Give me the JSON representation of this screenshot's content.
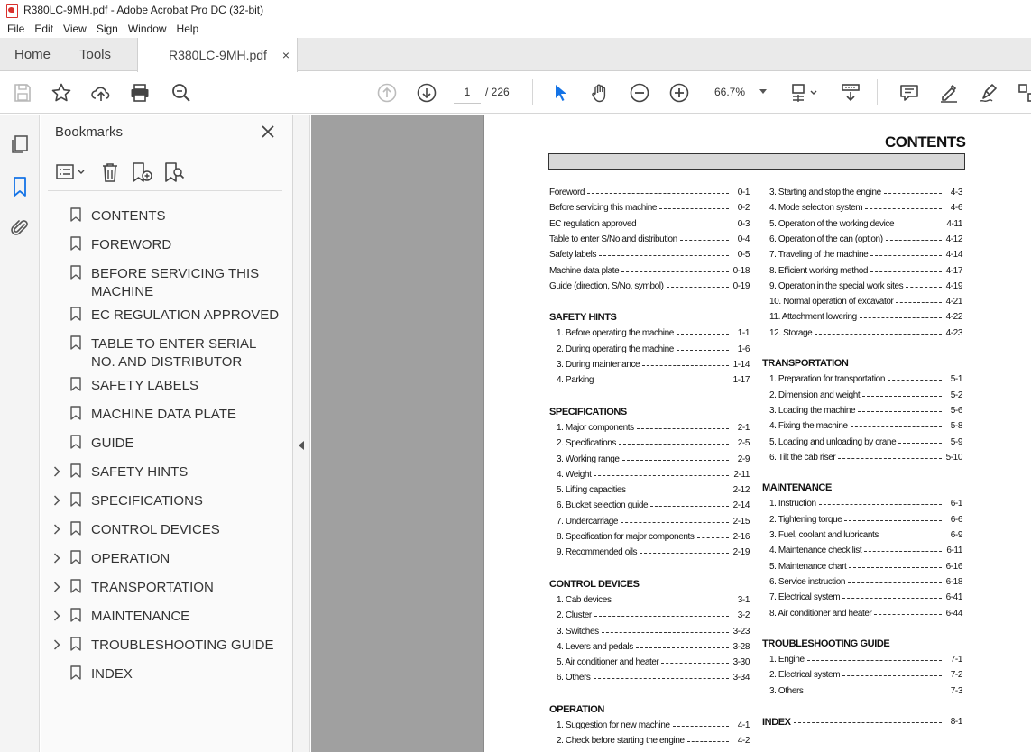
{
  "window": {
    "title": "R380LC-9MH.pdf - Adobe Acrobat Pro DC (32-bit)"
  },
  "menu": [
    "File",
    "Edit",
    "View",
    "Sign",
    "Window",
    "Help"
  ],
  "tabs": {
    "home": "Home",
    "tools": "Tools",
    "document": "R380LC-9MH.pdf",
    "close": "×"
  },
  "toolbar": {
    "page_current": "1",
    "page_total": "/ 226",
    "zoom": "66.7%"
  },
  "bookmarks": {
    "title": "Bookmarks",
    "items": [
      {
        "label": "CONTENTS",
        "expandable": false
      },
      {
        "label": "FOREWORD",
        "expandable": false
      },
      {
        "label": "BEFORE SERVICING THIS MACHINE",
        "expandable": false
      },
      {
        "label": "EC REGULATION APPROVED",
        "expandable": false
      },
      {
        "label": "TABLE TO ENTER SERIAL NO. AND DISTRIBUTOR",
        "expandable": false
      },
      {
        "label": "SAFETY LABELS",
        "expandable": false
      },
      {
        "label": "MACHINE DATA PLATE",
        "expandable": false
      },
      {
        "label": "GUIDE",
        "expandable": false
      },
      {
        "label": "SAFETY HINTS",
        "expandable": true
      },
      {
        "label": "SPECIFICATIONS",
        "expandable": true
      },
      {
        "label": "CONTROL DEVICES",
        "expandable": true
      },
      {
        "label": "OPERATION",
        "expandable": true
      },
      {
        "label": "TRANSPORTATION",
        "expandable": true
      },
      {
        "label": "MAINTENANCE",
        "expandable": true
      },
      {
        "label": "TROUBLESHOOTING GUIDE",
        "expandable": true
      },
      {
        "label": "INDEX",
        "expandable": false
      }
    ]
  },
  "document": {
    "title": "CONTENTS",
    "left": [
      {
        "kind": "line",
        "t": "Foreword",
        "p": "0-1"
      },
      {
        "kind": "line",
        "t": "Before servicing this machine",
        "p": "0-2"
      },
      {
        "kind": "line",
        "t": "EC regulation approved",
        "p": "0-3"
      },
      {
        "kind": "line",
        "t": "Table to enter S/No and distribution",
        "p": "0-4"
      },
      {
        "kind": "line",
        "t": "Safety labels",
        "p": "0-5"
      },
      {
        "kind": "line",
        "t": "Machine data plate",
        "p": "0-18"
      },
      {
        "kind": "line",
        "t": "Guide (direction, S/No, symbol)",
        "p": "0-19"
      },
      {
        "kind": "head",
        "t": "SAFETY HINTS"
      },
      {
        "kind": "sub",
        "t": "1. Before operating the machine",
        "p": "1-1"
      },
      {
        "kind": "sub",
        "t": "2. During operating the machine",
        "p": "1-6"
      },
      {
        "kind": "sub",
        "t": "3. During maintenance",
        "p": "1-14"
      },
      {
        "kind": "sub",
        "t": "4. Parking",
        "p": "1-17"
      },
      {
        "kind": "head",
        "t": "SPECIFICATIONS"
      },
      {
        "kind": "sub",
        "t": "1. Major components",
        "p": "2-1"
      },
      {
        "kind": "sub",
        "t": "2. Specifications",
        "p": "2-5"
      },
      {
        "kind": "sub",
        "t": "3. Working range",
        "p": "2-9"
      },
      {
        "kind": "sub",
        "t": "4. Weight",
        "p": "2-11"
      },
      {
        "kind": "sub",
        "t": "5. Lifting capacities",
        "p": "2-12"
      },
      {
        "kind": "sub",
        "t": "6. Bucket selection guide",
        "p": "2-14"
      },
      {
        "kind": "sub",
        "t": "7. Undercarriage",
        "p": "2-15"
      },
      {
        "kind": "sub",
        "t": "8. Specification for major components",
        "p": "2-16"
      },
      {
        "kind": "sub",
        "t": "9. Recommended oils",
        "p": "2-19"
      },
      {
        "kind": "head",
        "t": "CONTROL DEVICES"
      },
      {
        "kind": "sub",
        "t": "1. Cab devices",
        "p": "3-1"
      },
      {
        "kind": "sub",
        "t": "2. Cluster",
        "p": "3-2"
      },
      {
        "kind": "sub",
        "t": "3. Switches",
        "p": "3-23"
      },
      {
        "kind": "sub",
        "t": "4. Levers and pedals",
        "p": "3-28"
      },
      {
        "kind": "sub",
        "t": "5. Air conditioner and heater",
        "p": "3-30"
      },
      {
        "kind": "sub",
        "t": "6. Others",
        "p": "3-34"
      },
      {
        "kind": "head",
        "t": "OPERATION"
      },
      {
        "kind": "sub",
        "t": "1. Suggestion for new machine",
        "p": "4-1"
      },
      {
        "kind": "sub",
        "t": "2. Check before starting the engine",
        "p": "4-2"
      }
    ],
    "right": [
      {
        "kind": "sub",
        "t": "3. Starting and stop the engine",
        "p": "4-3"
      },
      {
        "kind": "sub",
        "t": "4. Mode selection system",
        "p": "4-6"
      },
      {
        "kind": "sub",
        "t": "5. Operation of the working device",
        "p": "4-11"
      },
      {
        "kind": "sub",
        "t": "6. Operation of the can (option)",
        "p": "4-12"
      },
      {
        "kind": "sub",
        "t": "7. Traveling of the machine",
        "p": "4-14"
      },
      {
        "kind": "sub",
        "t": "8. Efficient working method",
        "p": "4-17"
      },
      {
        "kind": "sub",
        "t": "9. Operation in the special work sites",
        "p": "4-19"
      },
      {
        "kind": "sub",
        "t": "10. Normal operation of excavator",
        "p": "4-21"
      },
      {
        "kind": "sub",
        "t": "11. Attachment lowering",
        "p": "4-22"
      },
      {
        "kind": "sub",
        "t": "12. Storage",
        "p": "4-23"
      },
      {
        "kind": "head",
        "t": "TRANSPORTATION"
      },
      {
        "kind": "sub",
        "t": "1. Preparation for transportation",
        "p": "5-1"
      },
      {
        "kind": "sub",
        "t": "2. Dimension and weight",
        "p": "5-2"
      },
      {
        "kind": "sub",
        "t": "3. Loading the machine",
        "p": "5-6"
      },
      {
        "kind": "sub",
        "t": "4. Fixing the machine",
        "p": "5-8"
      },
      {
        "kind": "sub",
        "t": "5. Loading and unloading by crane",
        "p": "5-9"
      },
      {
        "kind": "sub",
        "t": "6. Tilt the cab riser",
        "p": "5-10"
      },
      {
        "kind": "head",
        "t": "MAINTENANCE"
      },
      {
        "kind": "sub",
        "t": "1. Instruction",
        "p": "6-1"
      },
      {
        "kind": "sub",
        "t": "2. Tightening torque",
        "p": "6-6"
      },
      {
        "kind": "sub",
        "t": "3. Fuel, coolant and lubricants",
        "p": "6-9"
      },
      {
        "kind": "sub",
        "t": "4. Maintenance check list",
        "p": "6-11"
      },
      {
        "kind": "sub",
        "t": "5. Maintenance chart",
        "p": "6-16"
      },
      {
        "kind": "sub",
        "t": "6. Service instruction",
        "p": "6-18"
      },
      {
        "kind": "sub",
        "t": "7. Electrical system",
        "p": "6-41"
      },
      {
        "kind": "sub",
        "t": "8. Air conditioner and heater",
        "p": "6-44"
      },
      {
        "kind": "head",
        "t": "TROUBLESHOOTING GUIDE"
      },
      {
        "kind": "sub",
        "t": "1. Engine",
        "p": "7-1"
      },
      {
        "kind": "sub",
        "t": "2. Electrical system",
        "p": "7-2"
      },
      {
        "kind": "sub",
        "t": "3. Others",
        "p": "7-3"
      },
      {
        "kind": "headline",
        "t": "INDEX",
        "p": "8-1"
      }
    ]
  }
}
